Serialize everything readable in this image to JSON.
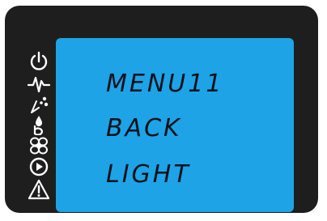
{
  "display": {
    "lines": [
      "MENU11",
      "BACK",
      "LIGHT"
    ]
  },
  "status_icons": [
    "power-icon",
    "pulse-icon",
    "snowflake-drop-icon",
    "fan-icon",
    "play-icon",
    "warning-icon"
  ],
  "colors": {
    "bezel": "#1e1e1e",
    "lcd_background": "#1ea3e6",
    "lcd_text": "#08121a",
    "icon": "#ffffff"
  }
}
